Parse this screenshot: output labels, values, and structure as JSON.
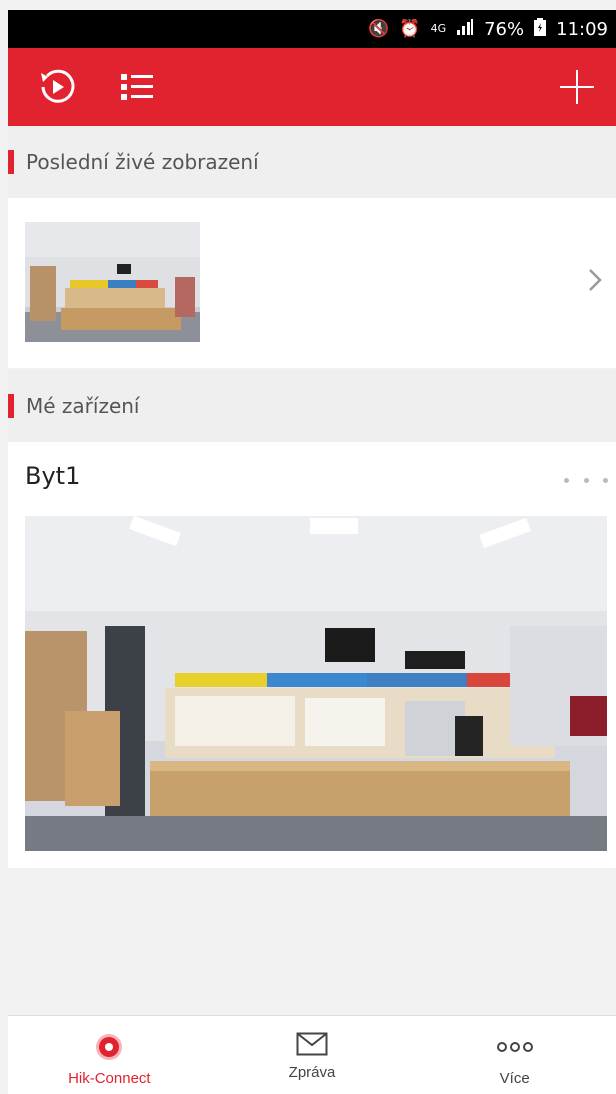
{
  "status_bar": {
    "network": "4G",
    "battery": "76%",
    "time": "11:09"
  },
  "toolbar": {
    "history_icon": "playback-history-icon",
    "list_icon": "list-icon",
    "add_icon": "plus-icon"
  },
  "sections": {
    "recent_title": "Poslední živé zobrazení",
    "devices_title": "Mé zařízení"
  },
  "device": {
    "name": "Byt1"
  },
  "bottom_nav": {
    "items": [
      {
        "label": "Hik-Connect",
        "icon": "hik-connect-icon",
        "active": true
      },
      {
        "label": "Zpráva",
        "icon": "envelope-icon",
        "active": false
      },
      {
        "label": "Více",
        "icon": "more-icon",
        "active": false
      }
    ]
  },
  "colors": {
    "accent": "#e1222f",
    "background": "#f2f2f2"
  }
}
